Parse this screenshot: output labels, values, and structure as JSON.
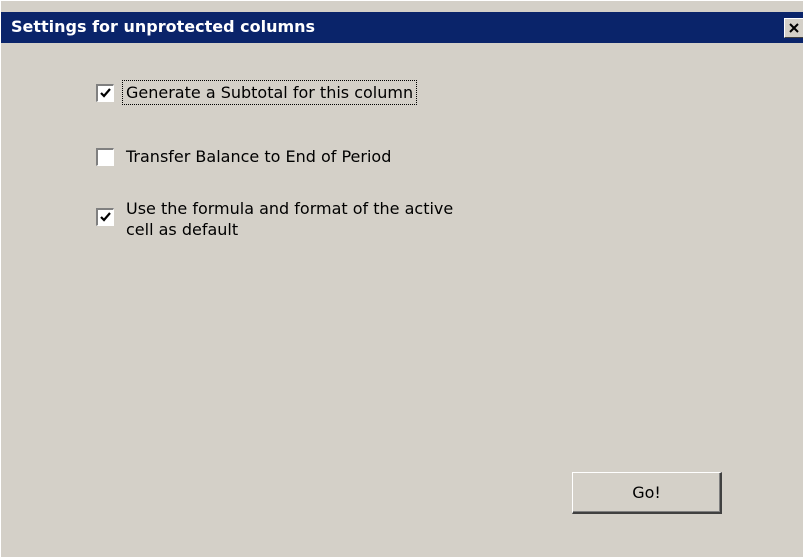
{
  "window": {
    "title": "Settings for unprotected columns",
    "close_glyph": "×",
    "title_bar_color": "#0a246a",
    "background_color": "#d4d0c8"
  },
  "options": [
    {
      "label": "Generate a Subtotal for this column",
      "checked": true,
      "focused": true
    },
    {
      "label": "Transfer Balance to End of Period",
      "checked": false,
      "focused": false
    },
    {
      "label_line1": "Use the formula and format of the active",
      "label_line2": "cell as default",
      "checked": true,
      "focused": false
    }
  ],
  "buttons": {
    "go_label": "Go!"
  },
  "icons": {
    "close": "close-icon",
    "check": "checkmark-icon"
  }
}
